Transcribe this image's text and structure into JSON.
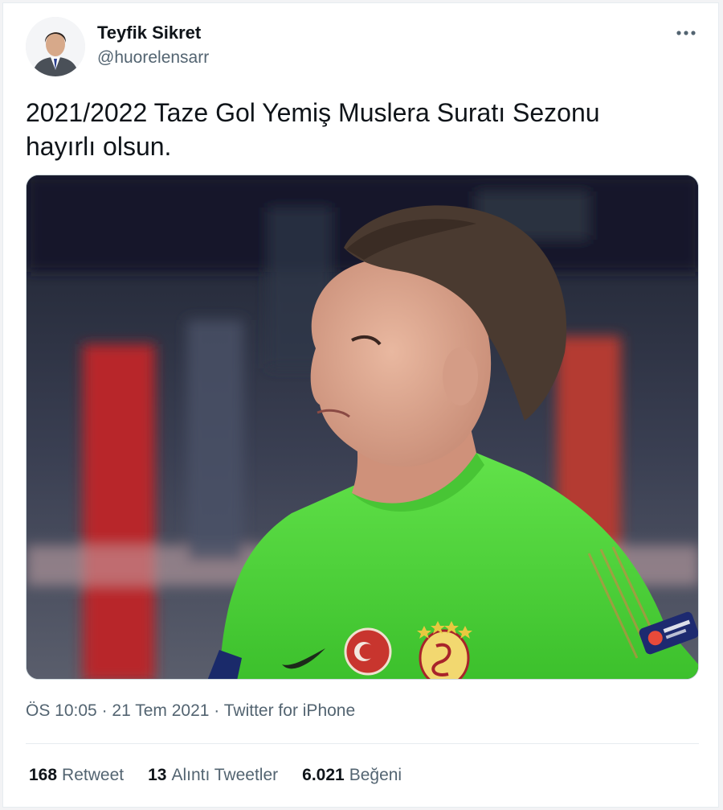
{
  "author": {
    "name": "Teyfik Sikret",
    "handle": "@huorelensarr"
  },
  "tweet": {
    "text": "2021/2022 Taze Gol Yemiş Muslera Suratı Sezonu hayırlı olsun."
  },
  "meta": {
    "time": "ÖS 10:05",
    "separator1": " · ",
    "date": "21 Tem 2021",
    "separator2": " · ",
    "source": "Twitter for iPhone"
  },
  "stats": [
    {
      "value": "168",
      "label": "Retweet"
    },
    {
      "value": "13",
      "label": "Alıntı Tweetler"
    },
    {
      "value": "6.021",
      "label": "Beğeni"
    }
  ],
  "icons": {
    "more": "more-horizontal-icon"
  },
  "colors": {
    "text_primary": "#0f1419",
    "text_secondary": "#536471",
    "border": "#e6ecf0",
    "jersey_green": "#4ed43a"
  }
}
